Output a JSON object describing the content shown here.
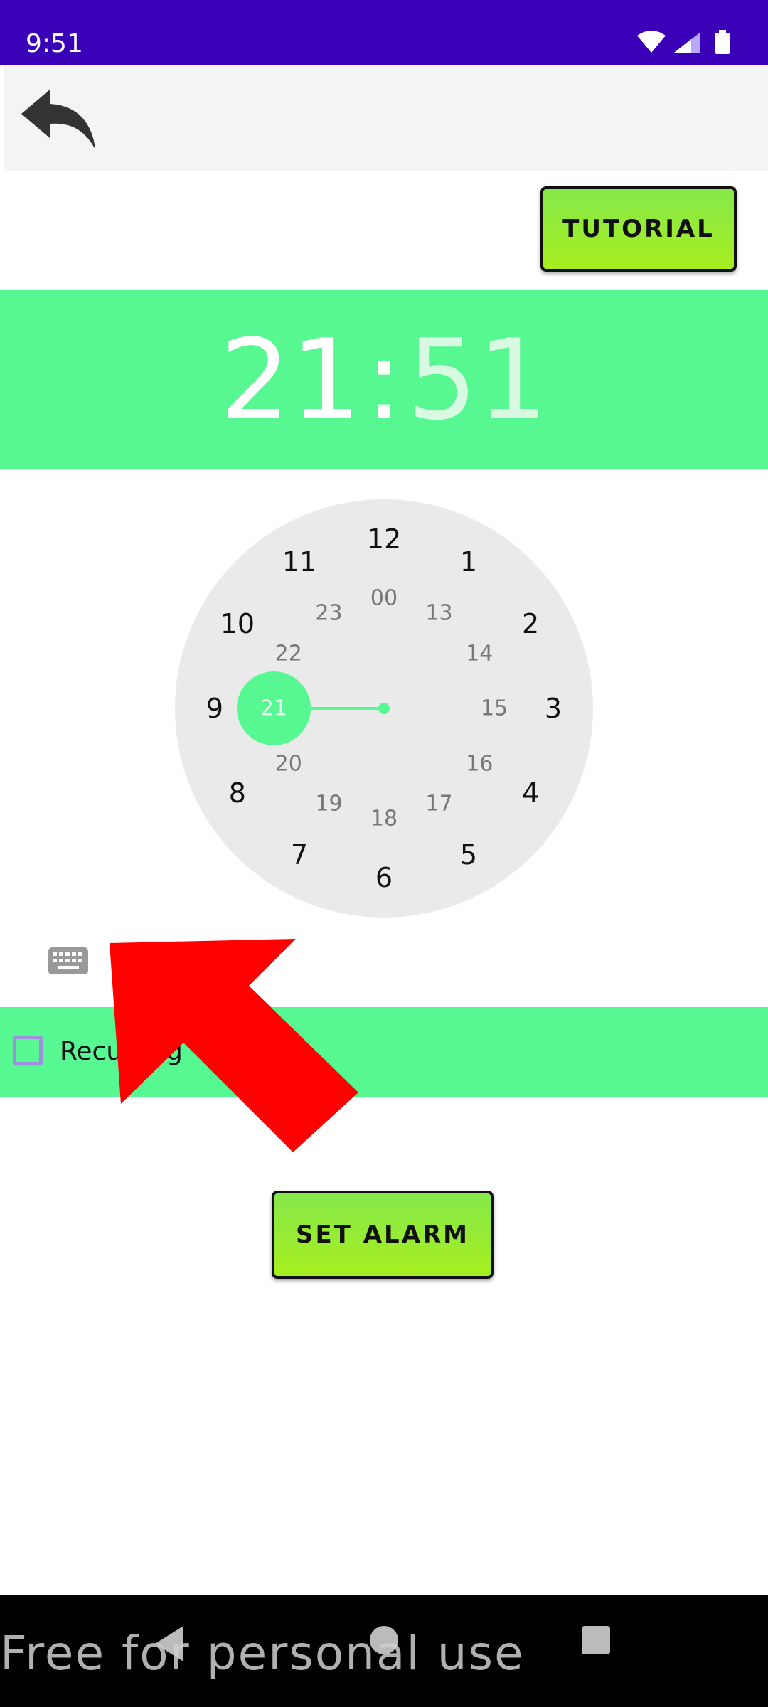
{
  "status_bar": {
    "time": "9:51"
  },
  "toolbar": {
    "tutorial_label": "TUTORIAL"
  },
  "time_picker": {
    "hour": "21",
    "separator": ":",
    "minute": "51",
    "outer_numbers": [
      "12",
      "1",
      "2",
      "3",
      "4",
      "5",
      "6",
      "7",
      "8",
      "9",
      "10",
      "11"
    ],
    "inner_numbers": [
      "00",
      "13",
      "14",
      "15",
      "16",
      "17",
      "18",
      "19",
      "20",
      "21",
      "22",
      "23"
    ],
    "selected": "21"
  },
  "recurring": {
    "label": "Recurring",
    "checked": false
  },
  "actions": {
    "set_alarm_label": "SET ALARM"
  },
  "watermark": "Free for personal use",
  "colors": {
    "status_bar": "#3a00b8",
    "accent_green": "#57f891",
    "button_green": "#a6ee1e",
    "clock_face": "#eaeaea",
    "overlay_arrow": "#ff0000"
  }
}
